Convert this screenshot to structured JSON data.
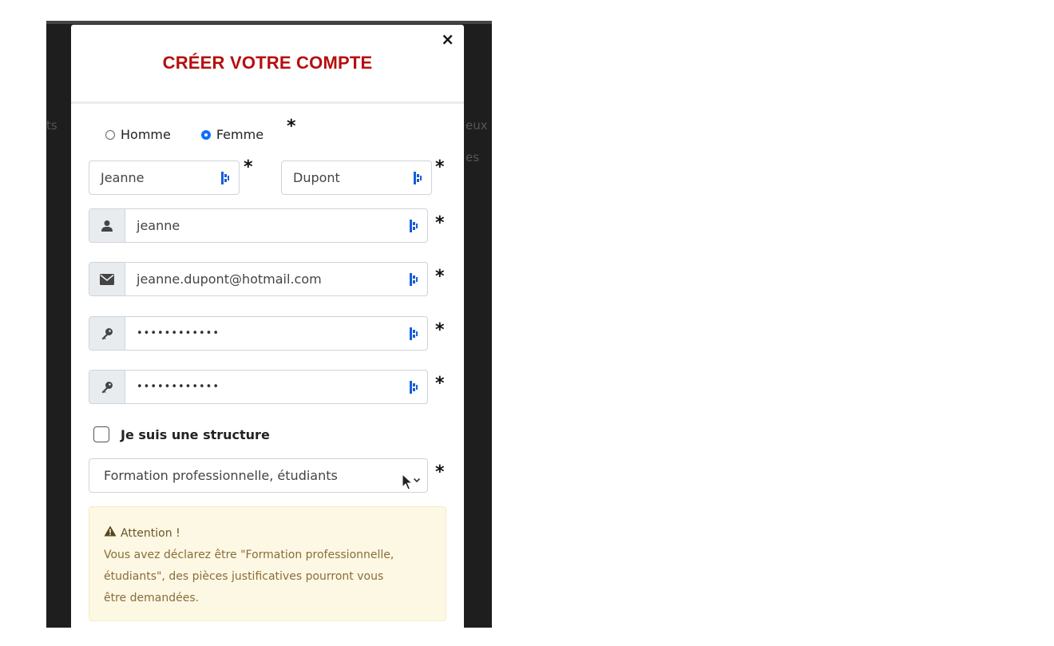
{
  "background": {
    "left_text": "ts",
    "right_text_1": "eux",
    "right_text_2": "es"
  },
  "modal": {
    "title": "CRÉER VOTRE COMPTE",
    "close_symbol": "×",
    "required_marker": "*",
    "title_color": "#b70e0e"
  },
  "gender": {
    "options": [
      "Homme",
      "Femme"
    ],
    "selected": "Femme"
  },
  "form": {
    "first_name": "Jeanne",
    "last_name": "Dupont",
    "username": "jeanne",
    "email": "jeanne.dupont@hotmail.com",
    "password": "••••••••••••",
    "password_confirm": "••••••••••••",
    "structure_label": "Je suis une structure",
    "structure_checked": false,
    "status_select": "Formation professionnelle, étudiants"
  },
  "icons": {
    "username": "user-icon",
    "email": "envelope-icon",
    "password": "key-icon",
    "field_extension": "bitwarden-icon",
    "warning": "warning-triangle-icon"
  },
  "alert": {
    "title": "Attention !",
    "line1": "Vous avez déclarez être \"Formation professionnelle,",
    "line2": "étudiants\", des pièces justificatives pourront vous",
    "line3": "être demandées."
  }
}
